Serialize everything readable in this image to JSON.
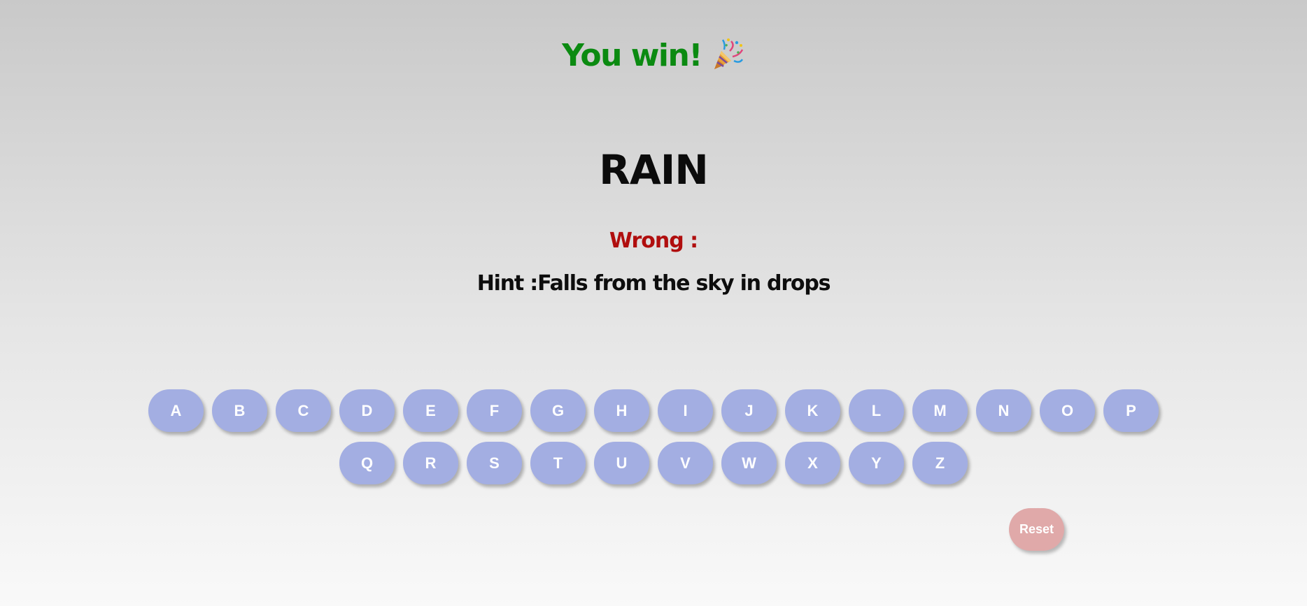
{
  "status": {
    "message": "You win!",
    "emoji_icon": "party-popper-icon",
    "color": "#0b8a11"
  },
  "word": {
    "display": "RAIN"
  },
  "wrong": {
    "label": "Wrong :",
    "letters": "",
    "color": "#b00e0e"
  },
  "hint": {
    "text": "Hint :Falls from the sky in drops"
  },
  "keyboard": {
    "row1": [
      "A",
      "B",
      "C",
      "D",
      "E",
      "F",
      "G",
      "H",
      "I",
      "J",
      "K",
      "L",
      "M",
      "N",
      "O",
      "P"
    ],
    "row2": [
      "Q",
      "R",
      "S",
      "T",
      "U",
      "V",
      "W",
      "X",
      "Y",
      "Z"
    ],
    "key_color": "#a3aee2"
  },
  "reset": {
    "label": "Reset",
    "color": "#e0a9a9"
  }
}
